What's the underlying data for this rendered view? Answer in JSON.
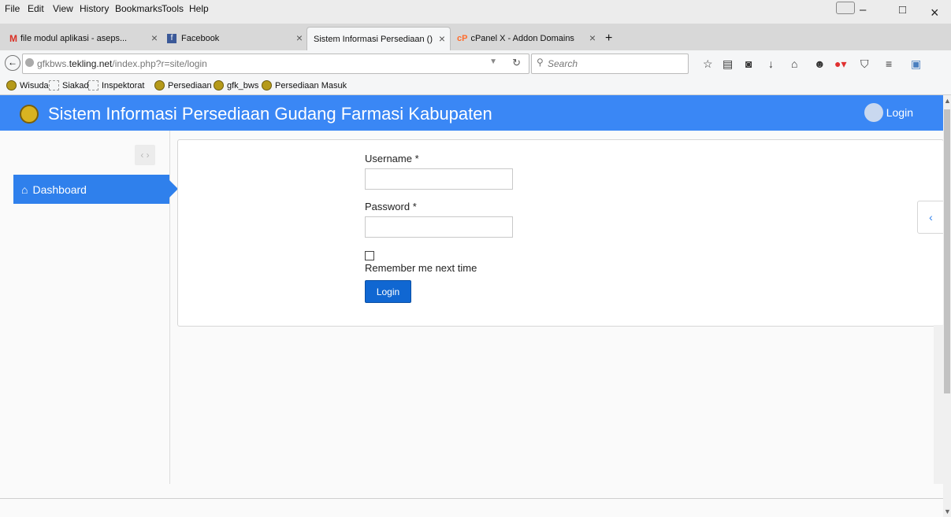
{
  "menubar": {
    "items": [
      "File",
      "Edit",
      "View",
      "History",
      "Bookmarks",
      "Tools",
      "Help"
    ]
  },
  "window_controls": {
    "minimize": "–",
    "restore": "□",
    "close": "×"
  },
  "tabs": [
    {
      "label": "file modul aplikasi - aseps...",
      "icon": "gmail-icon"
    },
    {
      "label": "Facebook",
      "icon": "facebook-icon"
    },
    {
      "label": "Sistem Informasi Persediaan ()",
      "icon": "page-icon"
    },
    {
      "label": "cPanel X - Addon Domains",
      "icon": "cpanel-icon"
    }
  ],
  "new_tab": "+",
  "url": {
    "prefix": "gfkbws.",
    "domain": "tekling.net",
    "path": "/index.php?r=site/login"
  },
  "search": {
    "placeholder": "Search"
  },
  "bookmarks": [
    "Wisuda",
    "Siakad",
    "Inspektorat",
    "Persediaan",
    "gfk_bws",
    "Persediaan Masuk"
  ],
  "app": {
    "title": "Sistem Informasi Persediaan Gudang Farmasi Kabupaten",
    "user_label": "Login",
    "accent": "#3a87f5"
  },
  "sidebar": {
    "toggle": "‹ ›",
    "items": [
      {
        "label": "Dashboard",
        "icon": "home-icon"
      }
    ]
  },
  "form": {
    "username_label": "Username *",
    "password_label": "Password *",
    "remember_label": "Remember me next time",
    "submit_label": "Login",
    "username_value": "",
    "password_value": ""
  },
  "collapse_button": "‹"
}
